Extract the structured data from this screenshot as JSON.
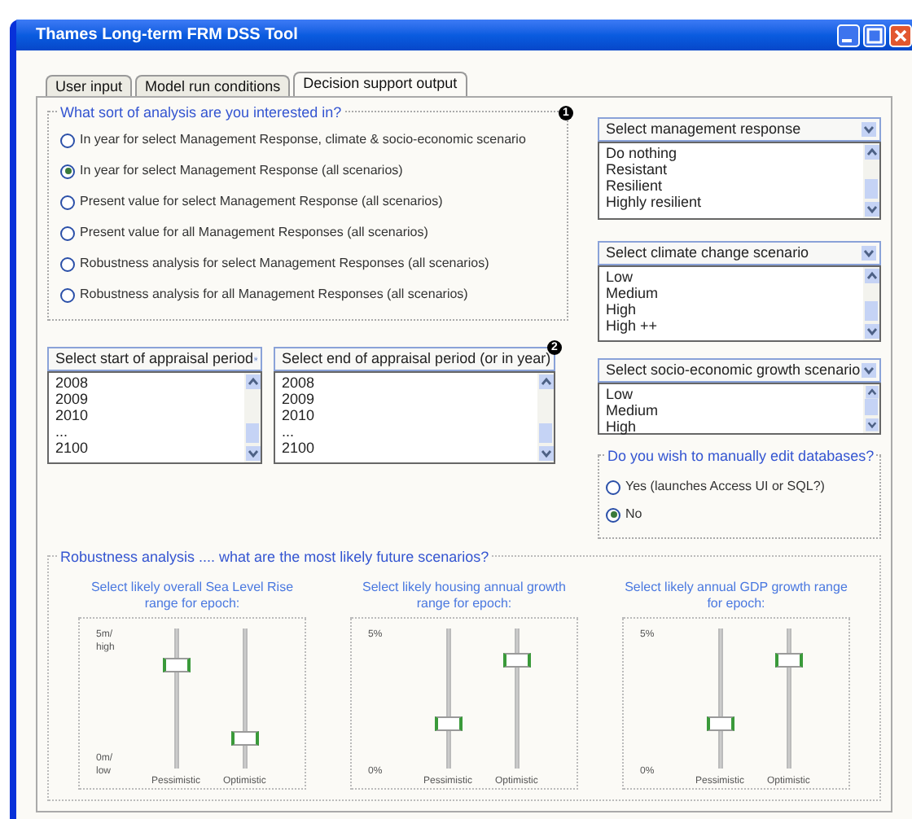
{
  "window": {
    "title": "Thames Long-term FRM DSS Tool"
  },
  "tabs": [
    {
      "label": "User input",
      "selected": false
    },
    {
      "label": "Model run conditions",
      "selected": false
    },
    {
      "label": "Decision support output",
      "selected": true
    }
  ],
  "analysis": {
    "title": "What sort of analysis are you interested in?",
    "badge": "1",
    "options": [
      {
        "label": "In year for select Management Response, climate & socio-economic scenario",
        "selected": false
      },
      {
        "label": "In year for select Management Response (all scenarios)",
        "selected": true
      },
      {
        "label": "Present value for select Management Response (all scenarios)",
        "selected": false
      },
      {
        "label": "Present value for all Management Responses (all scenarios)",
        "selected": false
      },
      {
        "label": "Robustness analysis for select Management Responses (all scenarios)",
        "selected": false
      },
      {
        "label": "Robustness analysis for all Management Responses (all scenarios)",
        "selected": false
      }
    ]
  },
  "period_lists": [
    {
      "header": "Select start of appraisal period",
      "items": [
        "2008",
        "2009",
        "2010",
        "...",
        "2100"
      ]
    },
    {
      "header": "Select end of appraisal period (or in year)",
      "badge": "2",
      "items": [
        "2008",
        "2009",
        "2010",
        "...",
        "2100"
      ]
    }
  ],
  "scenario_lists": [
    {
      "header": "Select management response",
      "items": [
        "Do nothing",
        "Resistant",
        "Resilient",
        "Highly resilient"
      ]
    },
    {
      "header": "Select climate change scenario",
      "items": [
        "Low",
        "Medium",
        "High",
        "High ++"
      ]
    },
    {
      "header": "Select socio-economic growth scenario",
      "items": [
        "Low",
        "Medium",
        "High"
      ]
    }
  ],
  "edit_databases": {
    "title": "Do you wish to manually edit databases?",
    "options": [
      {
        "label": "Yes (launches Access UI or SQL?)",
        "selected": false
      },
      {
        "label": "No",
        "selected": true
      }
    ]
  },
  "robustness": {
    "title": "Robustness analysis .... what are the most likely future scenarios?",
    "panels": [
      {
        "title": "Select likely overall Sea Level Rise range for epoch:",
        "top_label": "5m/ high",
        "bottom_label": "0m/ low",
        "sliders": [
          {
            "label": "Pessimistic",
            "level": 0.74
          },
          {
            "label": "Optimistic",
            "level": 0.22
          }
        ]
      },
      {
        "title": "Select likely housing annual growth range for epoch:",
        "top_label": "5%",
        "bottom_label": "0%",
        "sliders": [
          {
            "label": "Pessimistic",
            "level": 0.32
          },
          {
            "label": "Optimistic",
            "level": 0.78
          }
        ]
      },
      {
        "title": "Select likely annual GDP growth range for epoch:",
        "top_label": "5%",
        "bottom_label": "0%",
        "sliders": [
          {
            "label": "Pessimistic",
            "level": 0.32
          },
          {
            "label": "Optimistic",
            "level": 0.78
          }
        ]
      }
    ]
  }
}
